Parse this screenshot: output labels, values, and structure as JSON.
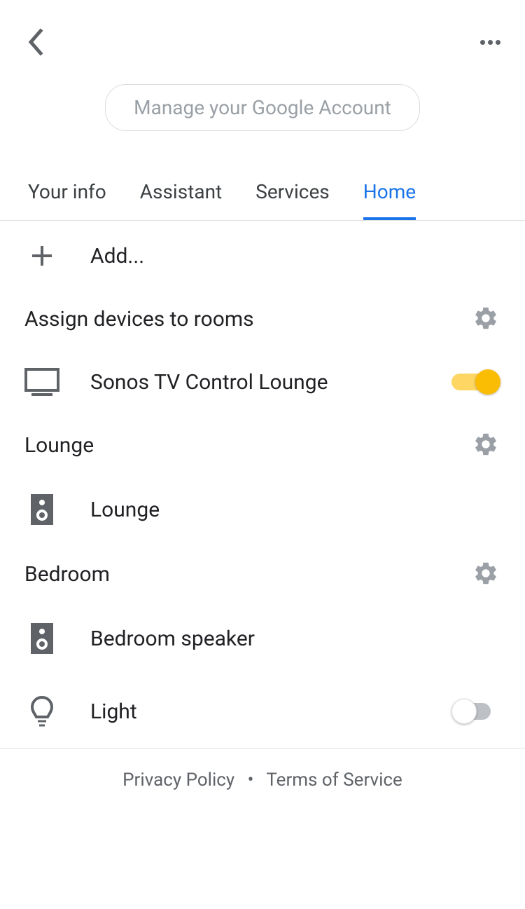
{
  "header": {
    "manage_account_label": "Manage your Google Account"
  },
  "tabs": [
    {
      "label": "Your info",
      "active": false
    },
    {
      "label": "Assistant",
      "active": false
    },
    {
      "label": "Services",
      "active": false
    },
    {
      "label": "Home",
      "active": true
    }
  ],
  "add": {
    "label": "Add..."
  },
  "sections": [
    {
      "title": "Assign devices to rooms",
      "devices": [
        {
          "name": "Sonos TV Control Lounge",
          "icon": "tv",
          "toggle": true,
          "toggle_on": true
        }
      ]
    },
    {
      "title": "Lounge",
      "devices": [
        {
          "name": "Lounge",
          "icon": "speaker",
          "toggle": false
        }
      ]
    },
    {
      "title": "Bedroom",
      "devices": [
        {
          "name": "Bedroom speaker",
          "icon": "speaker",
          "toggle": false
        },
        {
          "name": "Light",
          "icon": "light",
          "toggle": true,
          "toggle_on": false
        }
      ]
    }
  ],
  "footer": {
    "privacy": "Privacy Policy",
    "terms": "Terms of Service"
  }
}
